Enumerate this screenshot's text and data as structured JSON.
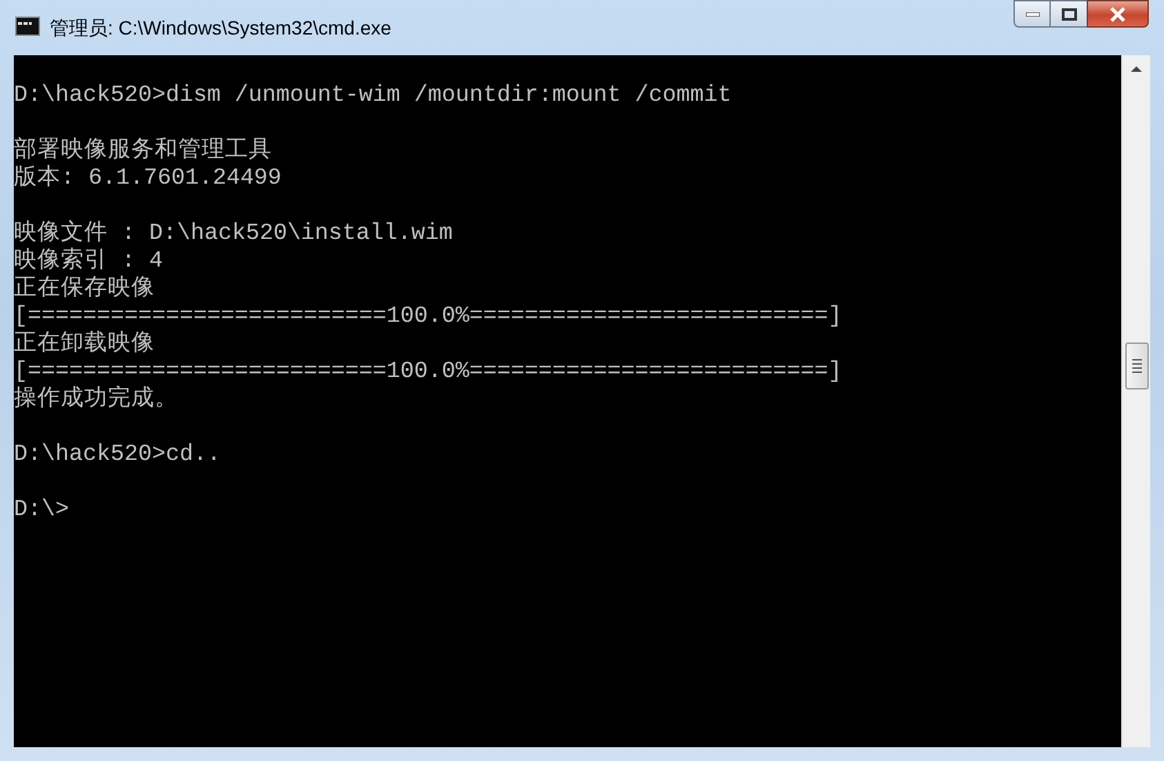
{
  "window": {
    "title": "管理员: C:\\Windows\\System32\\cmd.exe"
  },
  "console": {
    "blocks": [
      [
        "D:\\hack520>dism /unmount-wim /mountdir:mount /commit"
      ],
      [
        "部署映像服务和管理工具",
        "版本: 6.1.7601.24499"
      ],
      [
        "映像文件 : D:\\hack520\\install.wim",
        "映像索引 : 4",
        "正在保存映像",
        "[==========================100.0%==========================]",
        "正在卸载映像",
        "[==========================100.0%==========================]",
        "操作成功完成。"
      ],
      [
        "D:\\hack520>cd.."
      ],
      [
        "D:\\>"
      ]
    ]
  }
}
